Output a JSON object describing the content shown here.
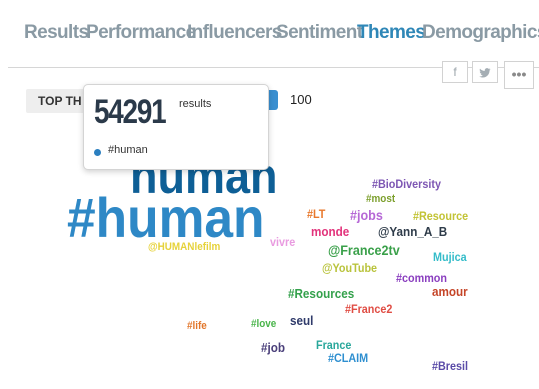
{
  "tabs": [
    {
      "label": "Results",
      "active": false
    },
    {
      "label": "Performance",
      "active": false
    },
    {
      "label": "Influencers",
      "active": false
    },
    {
      "label": "Sentiment",
      "active": false
    },
    {
      "label": "Themes",
      "active": true
    },
    {
      "label": "Demographics",
      "active": false
    }
  ],
  "share": {
    "facebook_icon": "f",
    "twitter_icon": "t",
    "more_icon": "•••"
  },
  "controls": {
    "top_label": "TOP TH",
    "option_100": "100"
  },
  "tooltip": {
    "count": "54291",
    "results_label": "results",
    "term": "#human"
  },
  "word_cloud": [
    {
      "text": "human",
      "color": "#0e5f96"
    },
    {
      "text": "#human",
      "color": "#2e88c6"
    },
    {
      "text": "@HUMANlefilm",
      "color": "#e6d23a"
    },
    {
      "text": "vivre",
      "color": "#e99be0"
    },
    {
      "text": "#BioDiversity",
      "color": "#7d56b3"
    },
    {
      "text": "#most",
      "color": "#7c9f2c"
    },
    {
      "text": "#LT",
      "color": "#e8782c"
    },
    {
      "text": "#jobs",
      "color": "#b668d6"
    },
    {
      "text": "#Resource",
      "color": "#c2c334"
    },
    {
      "text": "monde",
      "color": "#e2337b"
    },
    {
      "text": "@Yann_A_B",
      "color": "#2f3c4a"
    },
    {
      "text": "@France2tv",
      "color": "#3aa04a"
    },
    {
      "text": "Mujica",
      "color": "#34bcc9"
    },
    {
      "text": "@YouTube",
      "color": "#b9c33c"
    },
    {
      "text": "#common",
      "color": "#8a3ebf"
    },
    {
      "text": "amour",
      "color": "#c54528"
    },
    {
      "text": "#Resources",
      "color": "#34a14c"
    },
    {
      "text": "#France2",
      "color": "#e04d44"
    },
    {
      "text": "#life",
      "color": "#e2772c"
    },
    {
      "text": "#love",
      "color": "#4ab54b"
    },
    {
      "text": "seul",
      "color": "#2f3a6a"
    },
    {
      "text": "#job",
      "color": "#4a3f7a"
    },
    {
      "text": "France",
      "color": "#29a79b"
    },
    {
      "text": "#CLAIM",
      "color": "#2e8fd0"
    },
    {
      "text": "#Bresil",
      "color": "#5a4ba8"
    }
  ]
}
